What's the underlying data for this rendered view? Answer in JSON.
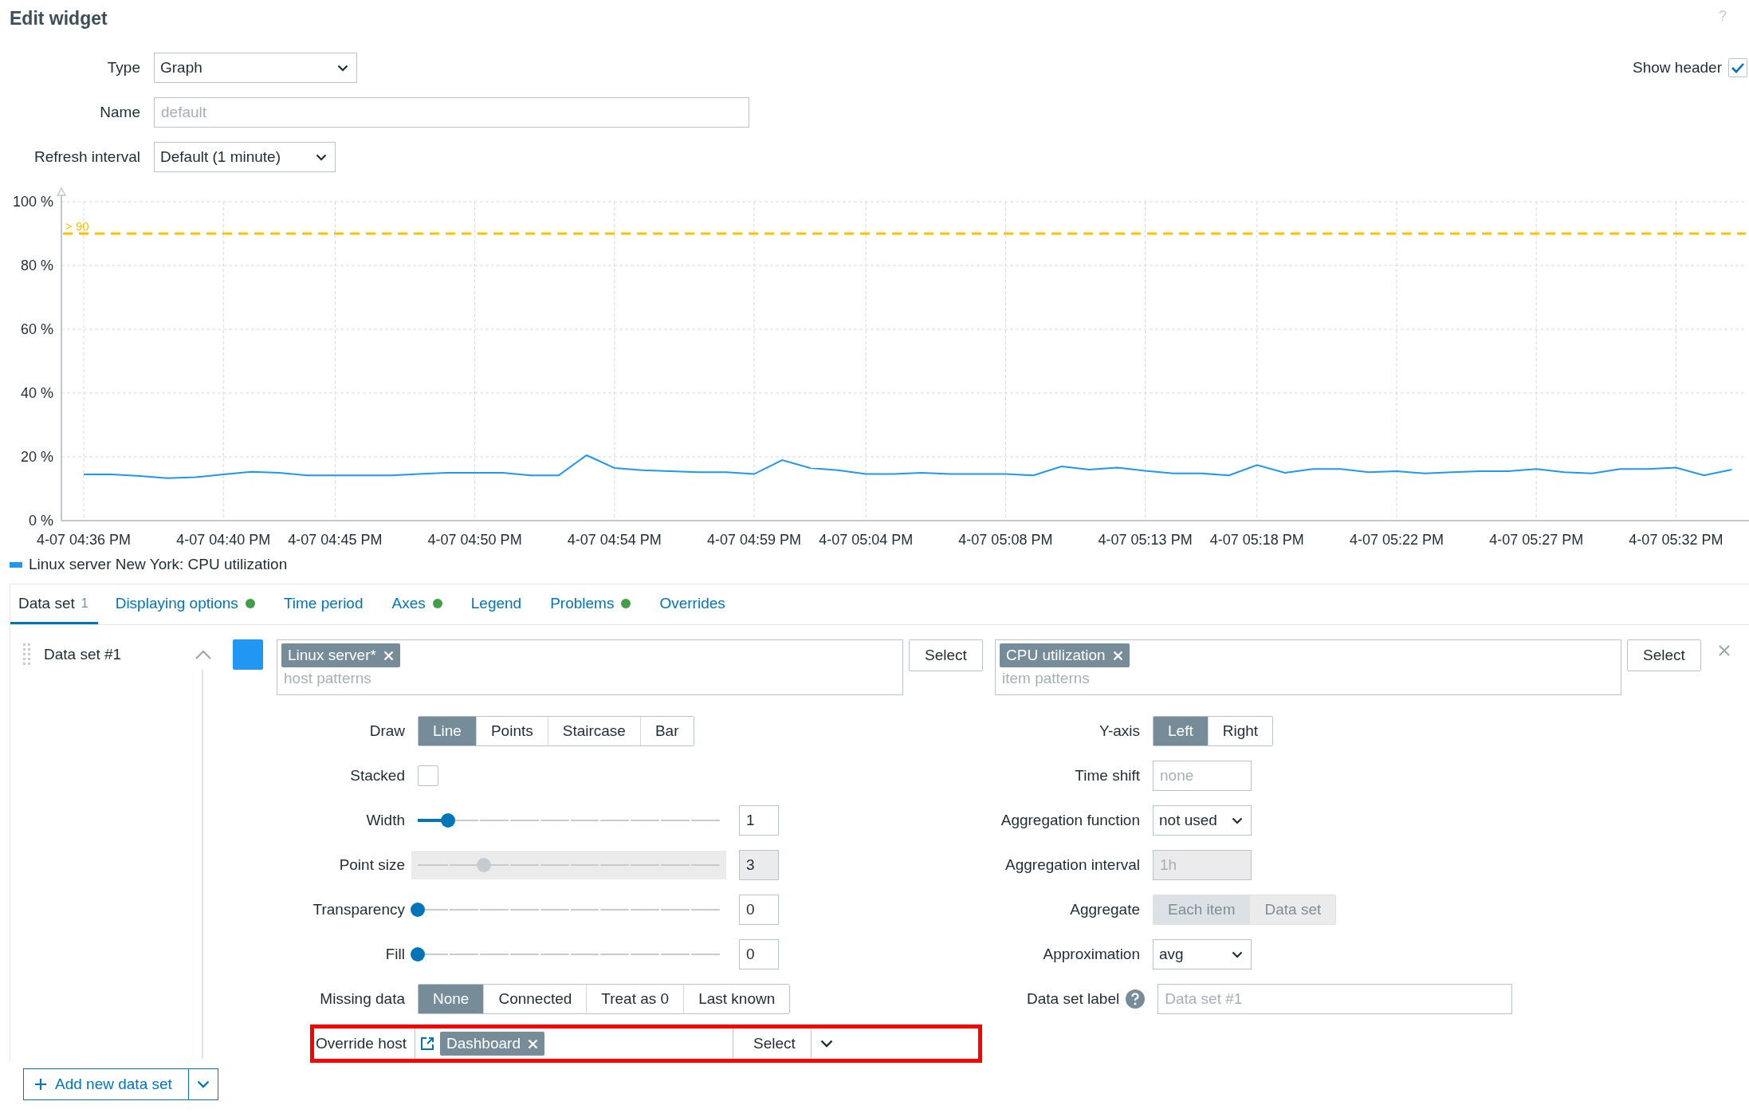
{
  "title": "Edit widget",
  "help_icon": "?",
  "fields": [
    {
      "label": "Type",
      "kind": "select",
      "value": "Graph"
    },
    {
      "label": "Name",
      "kind": "text",
      "placeholder": "default"
    },
    {
      "label": "Refresh interval",
      "kind": "select",
      "value": "Default (1 minute)"
    }
  ],
  "show_header": {
    "label": "Show header",
    "checked": true
  },
  "chart_data": {
    "type": "line",
    "grid": true,
    "ylim": [
      0,
      100
    ],
    "categories": [
      "4-07 04:36 PM",
      null,
      null,
      null,
      null,
      "4-07 04:40 PM",
      null,
      null,
      null,
      "4-07 04:45 PM",
      null,
      null,
      null,
      null,
      "4-07 04:50 PM",
      null,
      null,
      null,
      null,
      "4-07 04:54 PM",
      null,
      null,
      null,
      null,
      "4-07 04:59 PM",
      null,
      null,
      null,
      "4-07 05:04 PM",
      null,
      null,
      null,
      null,
      "4-07 05:08 PM",
      null,
      null,
      null,
      null,
      "4-07 05:13 PM",
      null,
      null,
      null,
      "4-07 05:18 PM",
      null,
      null,
      null,
      null,
      "4-07 05:22 PM",
      null,
      null,
      null,
      null,
      "4-07 05:27 PM",
      null,
      null,
      null,
      null,
      "4-07 05:32 PM",
      null,
      null
    ],
    "yticks": [
      {
        "value": 0,
        "label": "0 %"
      },
      {
        "value": 20,
        "label": "20 %"
      },
      {
        "value": 40,
        "label": "40 %"
      },
      {
        "value": 60,
        "label": "60 %"
      },
      {
        "value": 80,
        "label": "80 %"
      },
      {
        "value": 100,
        "label": "100 %"
      }
    ],
    "series": [
      {
        "name": "Linux server New York: CPU utilization",
        "color": "#2196f3",
        "values": [
          14.5,
          14.5,
          14,
          13.3,
          13.6,
          14.5,
          15.3,
          15,
          14.2,
          14.2,
          14.2,
          14.2,
          14.6,
          15,
          15,
          15,
          14.2,
          14.2,
          20.5,
          16.5,
          15.8,
          15.5,
          15.2,
          15.2,
          14.6,
          19,
          16.5,
          15.8,
          14.6,
          14.6,
          15,
          14.6,
          14.6,
          14.6,
          14.2,
          17,
          16,
          16.6,
          15.6,
          14.8,
          14.8,
          14.2,
          17.4,
          15,
          16.2,
          16.2,
          15.2,
          15.5,
          14.8,
          15.2,
          15.5,
          15.5,
          16.2,
          15.2,
          14.8,
          16.2,
          16.2,
          16.6,
          14.2,
          16
        ]
      }
    ],
    "ref_lines": [
      {
        "axis": "y",
        "value": 90,
        "label": "> 90",
        "color": "#ffc000"
      }
    ]
  },
  "tabs": [
    {
      "label": "Data set",
      "count": "1",
      "indicator": false,
      "selected": true
    },
    {
      "label": "Displaying options",
      "indicator": true,
      "selected": false
    },
    {
      "label": "Time period",
      "indicator": false,
      "selected": false
    },
    {
      "label": "Axes",
      "indicator": true,
      "selected": false
    },
    {
      "label": "Legend",
      "indicator": false,
      "selected": false
    },
    {
      "label": "Problems",
      "indicator": true,
      "selected": false
    },
    {
      "label": "Overrides",
      "indicator": false,
      "selected": false
    }
  ],
  "data_set": {
    "name": "Data set #1",
    "expanded": true,
    "color": "#2196f3",
    "hosts": {
      "tags": [
        "Linux server*"
      ],
      "placeholder": "host patterns",
      "button": "Select"
    },
    "items": {
      "tags": [
        "CPU utilization"
      ],
      "placeholder": "item patterns",
      "button": "Select"
    },
    "left_rows": [
      {
        "kind": "segmented",
        "label": "Draw",
        "disabled": false,
        "options": [
          {
            "label": "Line",
            "selected": true
          },
          {
            "label": "Points",
            "selected": false
          },
          {
            "label": "Staircase",
            "selected": false
          },
          {
            "label": "Bar",
            "selected": false
          }
        ]
      },
      {
        "kind": "checkbox",
        "label": "Stacked",
        "checked": false
      },
      {
        "kind": "slider",
        "label": "Width",
        "level": 0.1,
        "value": "1",
        "disabled": false
      },
      {
        "kind": "slider",
        "label": "Point size",
        "level": 0.22,
        "value": "3",
        "disabled": true
      },
      {
        "kind": "slider",
        "label": "Transparency",
        "level": 0,
        "value": "0",
        "disabled": false
      },
      {
        "kind": "slider",
        "label": "Fill",
        "level": 0,
        "value": "0",
        "disabled": false
      },
      {
        "kind": "segmented",
        "label": "Missing data",
        "disabled": false,
        "options": [
          {
            "label": "None",
            "selected": true
          },
          {
            "label": "Connected",
            "selected": false
          },
          {
            "label": "Treat as 0",
            "selected": false
          },
          {
            "label": "Last known",
            "selected": false
          }
        ]
      },
      {
        "kind": "override",
        "label": "Override host",
        "highlighted": true,
        "tags": [
          "Dashboard"
        ],
        "button": "Select"
      }
    ],
    "right_rows": [
      {
        "kind": "segmented",
        "label": "Y-axis",
        "disabled": false,
        "options": [
          {
            "label": "Left",
            "selected": true
          },
          {
            "label": "Right",
            "selected": false
          }
        ]
      },
      {
        "kind": "text",
        "label": "Time shift",
        "placeholder": "none",
        "disabled": false
      },
      {
        "kind": "select",
        "label": "Aggregation function",
        "value": "not used"
      },
      {
        "kind": "text",
        "label": "Aggregation interval",
        "placeholder": "1h",
        "disabled": true
      },
      {
        "kind": "segmented",
        "label": "Aggregate",
        "disabled": true,
        "options": [
          {
            "label": "Each item",
            "selected": true
          },
          {
            "label": "Data set",
            "selected": false
          }
        ]
      },
      {
        "kind": "select",
        "label": "Approximation",
        "value": "avg"
      },
      {
        "kind": "wide-text",
        "label": "Data set label",
        "help": true,
        "placeholder": "Data set #1",
        "disabled": false
      }
    ]
  },
  "add_button": {
    "label": "Add new data set"
  }
}
